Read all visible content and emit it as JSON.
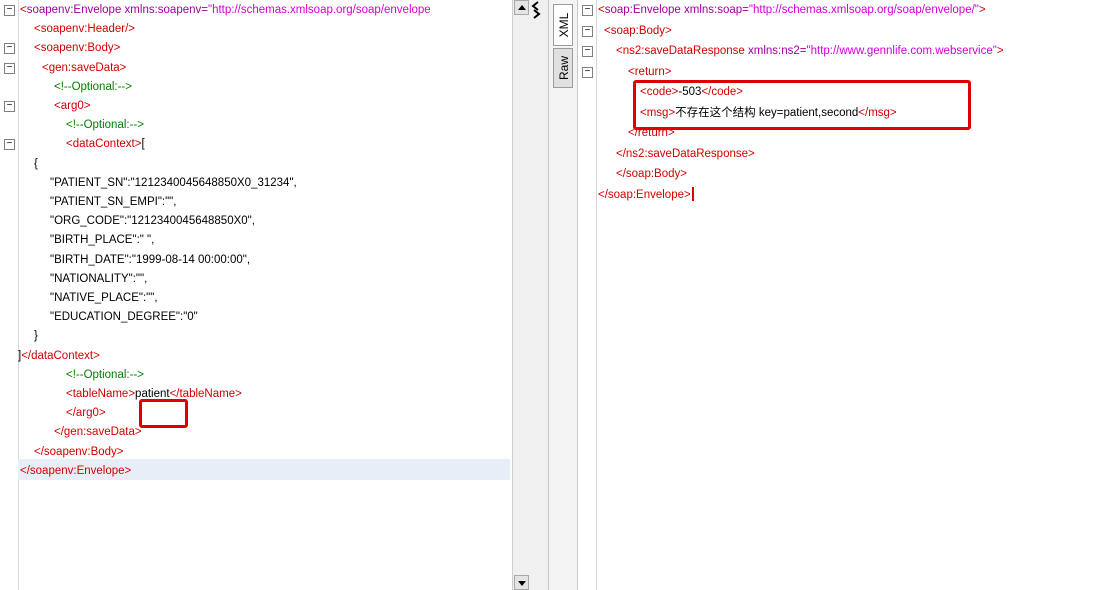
{
  "left_editor": {
    "lines": [
      {
        "fold": "minus",
        "parts": [
          [
            "tag",
            "<"
          ],
          [
            "ns",
            "soapenv:Envelope"
          ],
          [
            "attr",
            " xmlns:soapenv="
          ],
          [
            "val",
            "\"http://schemas.xmlsoap.org/soap/envelope"
          ]
        ]
      },
      {
        "fold": "",
        "parts": [
          [
            "tag",
            "<soapenv:Header/>"
          ]
        ]
      },
      {
        "fold": "minus",
        "parts": [
          [
            "tag",
            "<soapenv:Body>"
          ]
        ]
      },
      {
        "fold": "minus",
        "parts": [
          [
            "tag",
            "<gen:saveData>"
          ]
        ]
      },
      {
        "fold": "",
        "parts": [
          [
            "cmt",
            "<!--Optional:-->"
          ]
        ]
      },
      {
        "fold": "minus",
        "parts": [
          [
            "tag",
            "<arg0>"
          ]
        ]
      },
      {
        "fold": "",
        "parts": [
          [
            "cmt",
            "<!--Optional:-->"
          ]
        ]
      },
      {
        "fold": "minus",
        "parts": [
          [
            "tag",
            "<dataContext>"
          ],
          [
            "tx",
            "["
          ]
        ]
      },
      {
        "fold": "",
        "parts": [
          [
            "tx",
            "{"
          ]
        ]
      },
      {
        "fold": "",
        "parts": [
          [
            "tx",
            "\"PATIENT_SN\":\"1212340045648850X0_31234\","
          ]
        ]
      },
      {
        "fold": "",
        "parts": [
          [
            "tx",
            "\"PATIENT_SN_EMPI\":\"\","
          ]
        ]
      },
      {
        "fold": "",
        "parts": [
          [
            "tx",
            "\"ORG_CODE\":\"1212340045648850X0\","
          ]
        ]
      },
      {
        "fold": "",
        "parts": [
          [
            "tx",
            "\"BIRTH_PLACE\":\" \","
          ]
        ]
      },
      {
        "fold": "",
        "parts": [
          [
            "tx",
            "\"BIRTH_DATE\":\"1999-08-14 00:00:00\","
          ]
        ]
      },
      {
        "fold": "",
        "parts": [
          [
            "tx",
            "\"NATIONALITY\":\"\","
          ]
        ]
      },
      {
        "fold": "",
        "parts": [
          [
            "tx",
            "\"NATIVE_PLACE\":\"\","
          ]
        ]
      },
      {
        "fold": "",
        "parts": [
          [
            "tx",
            "\"EDUCATION_DEGREE\":\"0\""
          ]
        ]
      },
      {
        "fold": "",
        "parts": [
          [
            "tx",
            "}"
          ]
        ]
      },
      {
        "fold": "",
        "parts": [
          [
            "tx",
            "]"
          ],
          [
            "tag",
            "</dataContext>"
          ]
        ]
      },
      {
        "fold": "",
        "parts": [
          [
            "cmt",
            "<!--Optional:-->"
          ]
        ]
      },
      {
        "fold": "",
        "parts": [
          [
            "tag",
            "<tableName>"
          ],
          [
            "tx",
            "patient"
          ],
          [
            "tag",
            "</tableName>"
          ]
        ]
      },
      {
        "fold": "",
        "parts": [
          [
            "tag",
            "</arg0>"
          ]
        ]
      },
      {
        "fold": "",
        "parts": [
          [
            "tag",
            "</gen:saveData>"
          ]
        ]
      },
      {
        "fold": "",
        "parts": [
          [
            "tag",
            "</soapenv:Body>"
          ]
        ]
      },
      {
        "fold": "",
        "parts": [
          [
            "tag",
            "</soapenv:Envelope>"
          ]
        ]
      }
    ]
  },
  "view_tabs": {
    "xml": "XML",
    "raw": "Raw"
  },
  "right_editor": {
    "lines": [
      {
        "fold": "minus",
        "parts": [
          [
            "tag",
            "<"
          ],
          [
            "ns",
            "soap:Envelope"
          ],
          [
            "attr",
            " xmlns:soap="
          ],
          [
            "val",
            "\"http://schemas.xmlsoap.org/soap/envelope/\""
          ],
          [
            "tag",
            ">"
          ]
        ]
      },
      {
        "fold": "minus",
        "parts": [
          [
            "tag",
            "<soap:Body>"
          ]
        ]
      },
      {
        "fold": "minus",
        "parts": [
          [
            "tag",
            "<ns2:saveDataResponse"
          ],
          [
            "attr",
            " xmlns:ns2="
          ],
          [
            "val",
            "\"http://www.gennlife.com.webservice\""
          ],
          [
            "tag",
            ">"
          ]
        ]
      },
      {
        "fold": "minus",
        "parts": [
          [
            "tag",
            "<return>"
          ]
        ]
      },
      {
        "fold": "",
        "parts": [
          [
            "tag",
            "<code>"
          ],
          [
            "tx",
            "-503"
          ],
          [
            "tag",
            "</code>"
          ]
        ]
      },
      {
        "fold": "",
        "parts": [
          [
            "tag",
            "<msg>"
          ],
          [
            "tx",
            "不存在这个结构 key=patient,second"
          ],
          [
            "tag",
            "</msg>"
          ]
        ]
      },
      {
        "fold": "",
        "parts": [
          [
            "tag",
            "</return>"
          ]
        ]
      },
      {
        "fold": "",
        "parts": [
          [
            "tag",
            "</ns2:saveDataResponse>"
          ]
        ]
      },
      {
        "fold": "",
        "parts": [
          [
            "tag",
            "</soap:Body>"
          ]
        ]
      },
      {
        "fold": "",
        "parts": [
          [
            "tag",
            "</soap:Envelope>"
          ]
        ]
      }
    ]
  },
  "colors": {
    "tag": "#d10000",
    "comment": "#008000",
    "highlight_box": "#e00000"
  }
}
